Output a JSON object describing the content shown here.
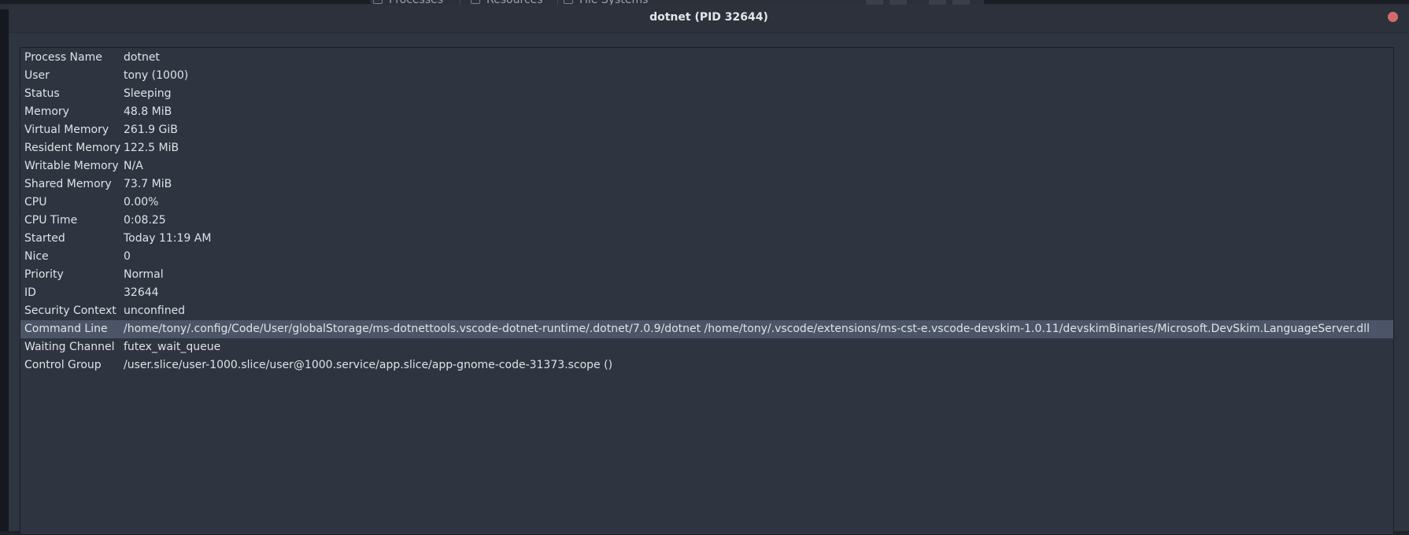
{
  "background": {
    "tabs": [
      {
        "label": "Processes"
      },
      {
        "label": "Resources"
      },
      {
        "label": "File Systems"
      }
    ]
  },
  "dialog": {
    "title": "dotnet (PID 32644)",
    "close_color": "#d16a6e",
    "selected_row_color": "#4c5567",
    "properties": [
      {
        "key": "Process Name",
        "value": "dotnet"
      },
      {
        "key": "User",
        "value": "tony (1000)"
      },
      {
        "key": "Status",
        "value": "Sleeping"
      },
      {
        "key": "Memory",
        "value": "48.8 MiB"
      },
      {
        "key": "Virtual Memory",
        "value": "261.9 GiB"
      },
      {
        "key": "Resident Memory",
        "value": "122.5 MiB"
      },
      {
        "key": "Writable Memory",
        "value": "N/A"
      },
      {
        "key": "Shared Memory",
        "value": "73.7 MiB"
      },
      {
        "key": "CPU",
        "value": "0.00%"
      },
      {
        "key": "CPU Time",
        "value": "0:08.25"
      },
      {
        "key": "Started",
        "value": "Today 11:19 AM"
      },
      {
        "key": "Nice",
        "value": "0"
      },
      {
        "key": "Priority",
        "value": "Normal"
      },
      {
        "key": "ID",
        "value": "32644"
      },
      {
        "key": "Security Context",
        "value": "unconfined"
      },
      {
        "key": "Command Line",
        "value": "/home/tony/.config/Code/User/globalStorage/ms-dotnettools.vscode-dotnet-runtime/.dotnet/7.0.9/dotnet /home/tony/.vscode/extensions/ms-cst-e.vscode-devskim-1.0.11/devskimBinaries/Microsoft.DevSkim.LanguageServer.dll",
        "selected": true
      },
      {
        "key": "Waiting Channel",
        "value": "futex_wait_queue"
      },
      {
        "key": "Control Group",
        "value": "/user.slice/user-1000.slice/user@1000.service/app.slice/app-gnome-code-31373.scope ()"
      }
    ]
  }
}
